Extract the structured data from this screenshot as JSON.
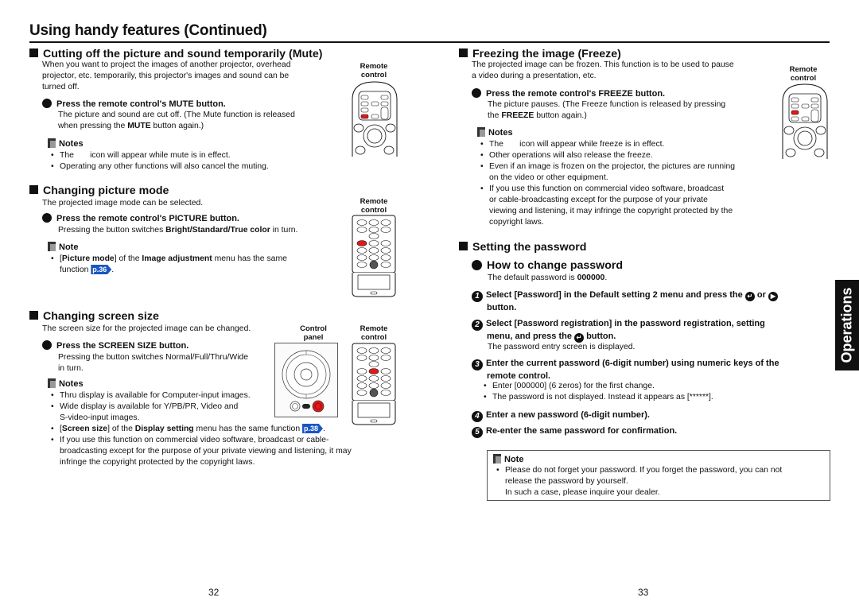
{
  "header": {
    "title": "Using handy features (Continued)"
  },
  "left": {
    "mute": {
      "heading": "Cutting off the picture and sound temporarily (Mute)",
      "intro": [
        "When you want to project the images of another projector, overhead",
        "projector, etc. temporarily, this projector's images and sound can be",
        "turned off."
      ],
      "step": "Press the remote control's MUTE button.",
      "step_desc_1": "The picture and sound are cut off. (The Mute function is released",
      "step_desc_2a": "when pressing the ",
      "step_desc_2b": "MUTE",
      "step_desc_2c": " button again.)",
      "notes_title": "Notes",
      "notes": [
        "The       icon will appear while mute is in effect.",
        "Operating any other functions will also cancel the muting."
      ],
      "figure_label": [
        "Remote",
        "control"
      ]
    },
    "picture": {
      "heading": "Changing picture mode",
      "intro": "The projected image mode can be selected.",
      "step": "Press the remote control's PICTURE button.",
      "step_desc_a": "Pressing the button switches ",
      "step_desc_b": "Bright/Standard/True color",
      "step_desc_c": " in turn.",
      "notes_title": "Note",
      "note_a": "[",
      "note_b": "Picture mode",
      "note_c": "] of the ",
      "note_d": "Image adjustment",
      "note_e": " menu has the same",
      "note_f": "function ",
      "note_ref": "p.36",
      "note_g": ".",
      "figure_label": [
        "Remote",
        "control"
      ]
    },
    "screen": {
      "heading": "Changing screen size",
      "intro": "The screen size for the projected image can be changed.",
      "step": "Press the SCREEN SIZE button.",
      "step_desc": [
        "Pressing the button switches Normal/Full/Thru/Wide",
        "in turn."
      ],
      "notes_title": "Notes",
      "notes": [
        "Thru display is available for Computer-input images.",
        "Wide display is available for Y/PB/PR, Video and",
        "S-video-input images."
      ],
      "note3_a": "[",
      "note3_b": "Screen size",
      "note3_c": "] of the ",
      "note3_d": "Display setting",
      "note3_e": " menu has the same function ",
      "note3_ref": "p.38",
      "note3_f": ".",
      "note4": [
        "If you use this function on commercial video software, broadcast or cable-",
        "broadcasting except for the purpose of your private viewing and listening, it may",
        "infringe the copyright protected by the copyright laws."
      ],
      "figure_label_panel": [
        "Control",
        "panel"
      ],
      "figure_label_remote": [
        "Remote",
        "control"
      ]
    },
    "page_number": "32"
  },
  "right": {
    "freeze": {
      "heading": "Freezing the image (Freeze)",
      "intro": [
        "The projected image can be frozen. This function is to be used to pause",
        "a video during a presentation, etc."
      ],
      "step": "Press the remote control's FREEZE button.",
      "step_desc_1": "The picture pauses. (The Freeze function is released by pressing",
      "step_desc_2a": "the ",
      "step_desc_2b": "FREEZE",
      "step_desc_2c": " button again.)",
      "notes_title": "Notes",
      "notes": [
        "The       icon will appear while freeze is in effect.",
        "Other operations will also release the freeze.",
        "Even if an image is frozen on the projector, the pictures are running",
        "on the video or other equipment.",
        "If you use this function on commercial video software, broadcast",
        "or cable-broadcasting except for the purpose of your private",
        "viewing and listening, it may infringe the copyright protected by the",
        "copyright laws."
      ],
      "figure_label": [
        "Remote",
        "control"
      ]
    },
    "password": {
      "heading": "Setting the password",
      "subheading": "How to change password",
      "default_a": "The default password is ",
      "default_b": "000000",
      "default_c": ".",
      "steps": [
        {
          "num": "1",
          "line1": "Select [Password] in the Default setting 2 menu and press the",
          "or": " or ",
          "line2": "button."
        },
        {
          "num": "2",
          "line1": "Select [Password registration] in the password registration, setting",
          "line2a": "menu, and press the ",
          "line2b": " button.",
          "desc": "The password entry screen is displayed."
        },
        {
          "num": "3",
          "line1": "Enter the current password (6-digit number) using numeric keys of the",
          "line2": "remote control.",
          "bullets": [
            "Enter [000000] (6 zeros) for the first change.",
            "The password is not displayed. Instead it appears as [******]."
          ]
        },
        {
          "num": "4",
          "line1": "Enter a new password (6-digit number)."
        },
        {
          "num": "5",
          "line1": "Re-enter the same password for confirmation."
        }
      ],
      "note_title": "Note",
      "note_lines": [
        "Please do not forget your password. If you forget the password, you can not",
        "release the password by yourself.",
        "In such a case, please inquire your dealer."
      ]
    },
    "side_tab": "Operations",
    "page_number": "33"
  },
  "icons": {
    "enter": "↵",
    "right_arrow": "▶"
  },
  "colors": {
    "accent_red": "#e0191b",
    "link_blue": "#1a56c4"
  }
}
